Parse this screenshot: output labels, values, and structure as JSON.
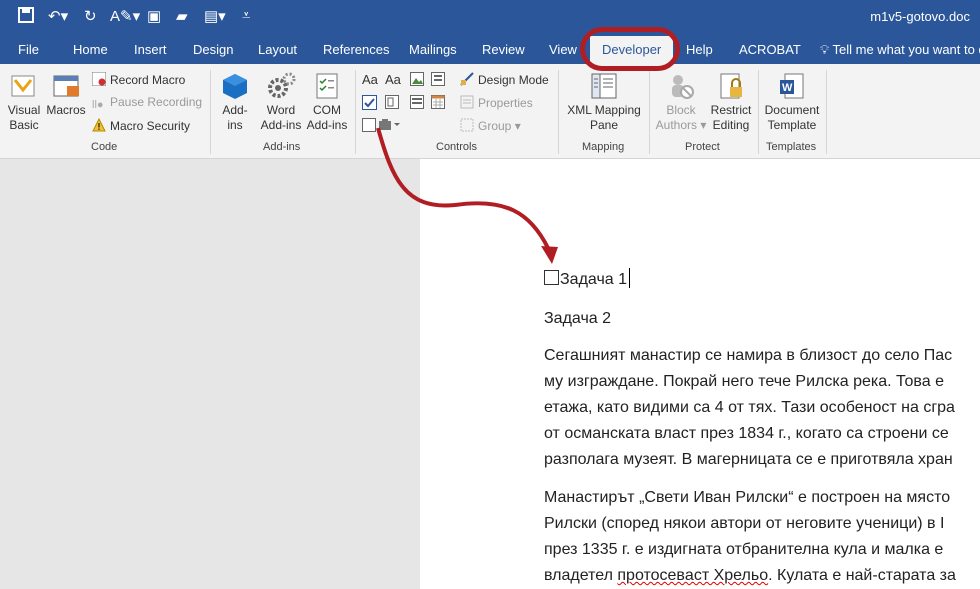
{
  "window": {
    "doc_title": "m1v5-gotovo.doc"
  },
  "tabs": [
    "File",
    "Home",
    "Insert",
    "Design",
    "Layout",
    "References",
    "Mailings",
    "Review",
    "View",
    "Developer",
    "Help",
    "ACROBAT"
  ],
  "active_tab": "Developer",
  "tell_me": "Tell me what you want to d",
  "ribbon": {
    "code": {
      "label": "Code",
      "visual_basic": [
        "Visual",
        "Basic"
      ],
      "macros": "Macros",
      "record_macro": "Record Macro",
      "pause_recording": "Pause Recording",
      "macro_security": "Macro Security"
    },
    "addins": {
      "label": "Add-ins",
      "addins_btn": [
        "Add-",
        "ins"
      ],
      "word_addins": [
        "Word",
        "Add-ins"
      ],
      "com_addins": [
        "COM",
        "Add-ins"
      ]
    },
    "controls": {
      "label": "Controls",
      "aa1": "Aa",
      "aa2": "Aa",
      "design_mode": "Design Mode",
      "properties": "Properties",
      "group": "Group"
    },
    "mapping": {
      "label": "Mapping",
      "xml_pane": [
        "XML Mapping",
        "Pane"
      ]
    },
    "protect": {
      "label": "Protect",
      "block_authors": [
        "Block",
        "Authors"
      ],
      "restrict_editing": [
        "Restrict",
        "Editing"
      ]
    },
    "templates": {
      "label": "Templates",
      "doc_template": [
        "Document",
        "Template"
      ]
    }
  },
  "document": {
    "line1": "Задача 1",
    "line2": "Задача 2",
    "p1": [
      "Сегашният манастир се намира в близост до село Пас",
      "му изграждане. Покрай него тече Рилска река. Това е",
      "етажа, като видими са 4 от тях. Тази особеност на сгра",
      "от османската власт през 1834 г., когато са строени се",
      "разполага музеят. В магерницата се е приготвяла хран"
    ],
    "p2_lines": [
      "Манастирът „Свети Иван Рилски“ е построен на място",
      "Рилски (според някои автори от неговите ученици) в І",
      "през 1335 г. е издигната отбранителна кула и малка е"
    ],
    "p2_last_pre": "владетел ",
    "p2_last_squiggle": "протосевaст Хрельо",
    "p2_last_post": ". Кулата е най-старата за"
  },
  "colors": {
    "accent": "#2b579a",
    "annotation": "#b01e23"
  }
}
